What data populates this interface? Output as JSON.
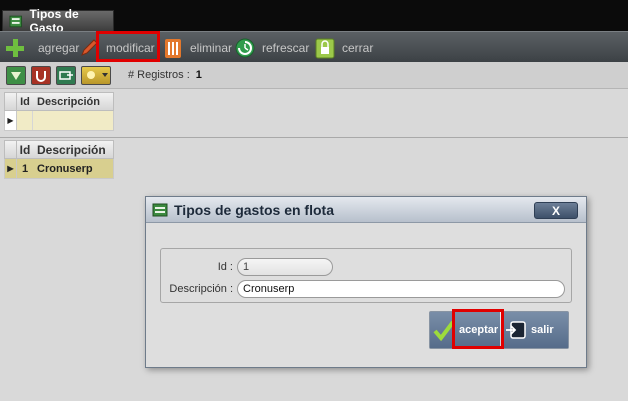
{
  "tab": {
    "title": "Tipos de Gasto",
    "icon": "form-icon"
  },
  "toolbar": {
    "buttons": [
      {
        "id": "agregar",
        "label": "agregar",
        "icon": "plus-icon",
        "color": "#5fa83a"
      },
      {
        "id": "modificar",
        "label": "modificar",
        "icon": "pencil-icon",
        "color": "#c0392b"
      },
      {
        "id": "eliminar",
        "label": "eliminar",
        "icon": "trash-icon",
        "color": "#d35400"
      },
      {
        "id": "refrescar",
        "label": "refrescar",
        "icon": "refresh-icon",
        "color": "#27ae60"
      },
      {
        "id": "cerrar",
        "label": "cerrar",
        "icon": "lock-icon",
        "color": "#7fb33a"
      }
    ]
  },
  "subtoolbar": {
    "buttons": [
      {
        "id": "filter",
        "icon": "filter-down-icon",
        "color": "#3aa14a"
      },
      {
        "id": "anchor",
        "icon": "anchor-icon",
        "color": "#c0392b"
      },
      {
        "id": "export",
        "icon": "export-icon",
        "color": "#2e8b57"
      },
      {
        "id": "options",
        "icon": "sun-dropdown-icon",
        "color": "#d8b428"
      }
    ],
    "registros_label": "# Registros :",
    "registros_count": "1"
  },
  "grid1": {
    "col_id": "Id",
    "col_desc": "Descripción"
  },
  "grid2": {
    "col_id": "Id",
    "col_desc": "Descripción",
    "rows": [
      {
        "id": "1",
        "desc": "Cronuserp"
      }
    ]
  },
  "modal": {
    "title": "Tipos de gastos en flota",
    "close_label": "X",
    "id_label": "Id :",
    "id_value": "1",
    "desc_label": "Descripción :",
    "desc_value": "Cronuserp",
    "accept_label": "aceptar",
    "exit_label": "salir"
  }
}
